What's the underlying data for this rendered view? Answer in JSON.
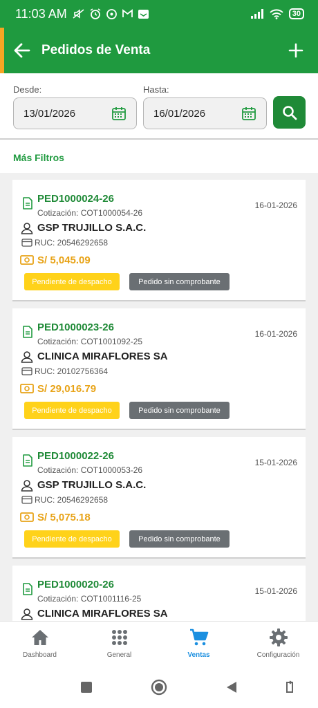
{
  "status_bar": {
    "time": "11:03 AM",
    "battery": "30",
    "icons": [
      "mute-icon",
      "alarm-icon",
      "whatsapp-icon",
      "gmail-icon",
      "mail-icon",
      "signal-icon",
      "wifi-icon",
      "battery-icon"
    ]
  },
  "header": {
    "title": "Pedidos de Venta",
    "accent_color": "#f5a623",
    "bar_color": "#1f9a3f"
  },
  "filters": {
    "desde_label": "Desde:",
    "desde_value": "13/01/2026",
    "hasta_label": "Hasta:",
    "hasta_value": "16/01/2026",
    "mas_filtros": "Más Filtros"
  },
  "orders": [
    {
      "code": "PED1000024-26",
      "date": "16-01-2026",
      "quote": "Cotización: COT1000054-26",
      "client": "GSP TRUJILLO S.A.C.",
      "ruc": "RUC: 20546292658",
      "amount": "S/ 5,045.09",
      "status": "Pendiente de despacho",
      "voucher": "Pedido sin comprobante"
    },
    {
      "code": "PED1000023-26",
      "date": "16-01-2026",
      "quote": "Cotización: COT1001092-25",
      "client": "CLINICA MIRAFLORES SA",
      "ruc": "RUC: 20102756364",
      "amount": "S/ 29,016.79",
      "status": "Pendiente de despacho",
      "voucher": "Pedido sin comprobante"
    },
    {
      "code": "PED1000022-26",
      "date": "15-01-2026",
      "quote": "Cotización: COT1000053-26",
      "client": "GSP TRUJILLO S.A.C.",
      "ruc": "RUC: 20546292658",
      "amount": "S/ 5,075.18",
      "status": "Pendiente de despacho",
      "voucher": "Pedido sin comprobante"
    },
    {
      "code": "PED1000020-26",
      "date": "15-01-2026",
      "quote": "Cotización: COT1001116-25",
      "client": "CLINICA MIRAFLORES SA"
    }
  ],
  "bottom_nav": [
    {
      "label": "Dashboard",
      "icon": "home-icon",
      "active": false
    },
    {
      "label": "General",
      "icon": "grid-icon",
      "active": false
    },
    {
      "label": "Ventas",
      "icon": "cart-icon",
      "active": true
    },
    {
      "label": "Configuración",
      "icon": "gear-icon",
      "active": false
    }
  ],
  "colors": {
    "primary_green": "#1f9a3f",
    "amount_orange": "#e8a317",
    "status_yellow": "#ffd21a",
    "voucher_gray": "#6a6f73",
    "active_blue": "#1b8fe0"
  }
}
